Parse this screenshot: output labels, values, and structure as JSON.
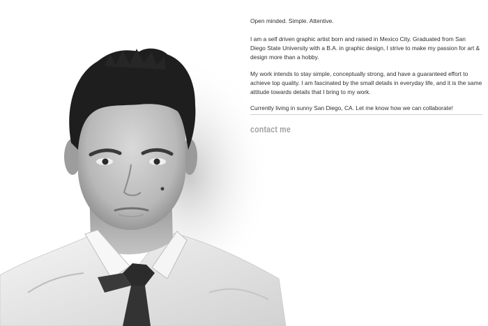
{
  "bio": {
    "tagline": "Open minded. Simple. Attentive.",
    "paragraph_1": "I am a self driven graphic artist born and raised in Mexico City.  Graduated from San Diego State University with a B.A. in graphic design, I strive to make my passion for art & design more than a hobby.",
    "paragraph_2": "My work intends to stay simple, conceptually strong, and have a guaranteed effort to achieve top quality. I am fascinated by the small details in everyday life, and it is the same attitude towards details that I bring to my work.",
    "paragraph_3": "Currently living in sunny San Diego, CA. Let me know how we can collaborate!"
  },
  "contact": {
    "label": "contact me"
  },
  "colors": {
    "background": "#ffffff",
    "text": "#2e2e2e",
    "link": "#a3a3a3",
    "divider": "#cfcfcf"
  }
}
